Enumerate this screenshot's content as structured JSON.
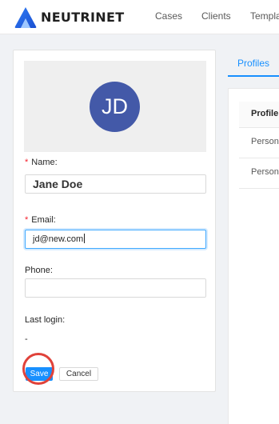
{
  "header": {
    "brand": "NEUTRINET",
    "nav": [
      "Cases",
      "Clients",
      "Templa"
    ]
  },
  "profile_card": {
    "avatar_initials": "JD",
    "name_label": "Name",
    "name_value": "Jane Doe",
    "email_label": "Email",
    "email_value": "jd@new.com",
    "phone_label": "Phone",
    "phone_value": "",
    "last_login_label": "Last login",
    "last_login_value": "-",
    "required_mark": "*",
    "label_suffix": ":",
    "save_label": "Save",
    "cancel_label": "Cancel"
  },
  "right_panel": {
    "tab": "Profiles",
    "column_header": "Profile",
    "rows": [
      "Person",
      "Person"
    ]
  },
  "colors": {
    "primary": "#1890ff",
    "avatar_bg": "#4359a8",
    "highlight": "#e0423a",
    "required": "#f5222d"
  }
}
